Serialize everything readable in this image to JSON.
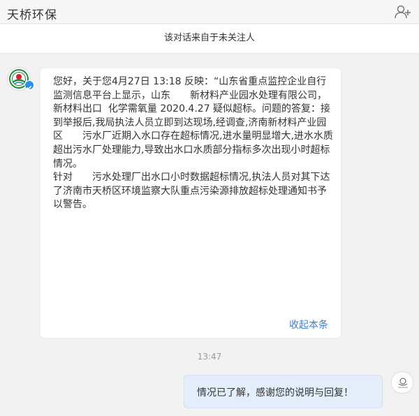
{
  "header": {
    "title": "天桥环保"
  },
  "notice": {
    "text": "该对话来自于未关注人"
  },
  "messages": {
    "incoming": {
      "text": "您好，关于您4月27日 13:18 反映：“山东省重点监控企业自行监测信息平台上显示，山东　　新材料产业园水处理有限公司，　　新材料出口  化学需氧量 2020.4.27 疑似超标。问题的答复：接到举报后,我局执法人员立即到达现场,经调查,济南新材料产业园区　　污水厂近期入水口存在超标情况,进水量明显增大,进水水质超出污水厂处理能力,导致出水口水质部分指标多次出现小时超标情况。\n针对　　污水处理厂出水口小时数据超标情况,执法人员对其下达了济南市天桥区环境监察大队重点污染源排放超标处理通知书予以警告。",
      "collapse_label": "收起本条"
    },
    "timestamp": "13:47",
    "outgoing": {
      "text": "情况已了解，感谢您的说明与回复！"
    }
  },
  "colors": {
    "page_bg": "#f2f2f2",
    "link": "#3f7fc8",
    "outgoing_bubble": "#e4eefb",
    "verified_badge": "#2f8ee6"
  },
  "icons": {
    "header_action": "add-user-icon",
    "avatar_left": "environmental-protection-logo",
    "badge": "verified-icon",
    "avatar_right": "user-avatar"
  }
}
